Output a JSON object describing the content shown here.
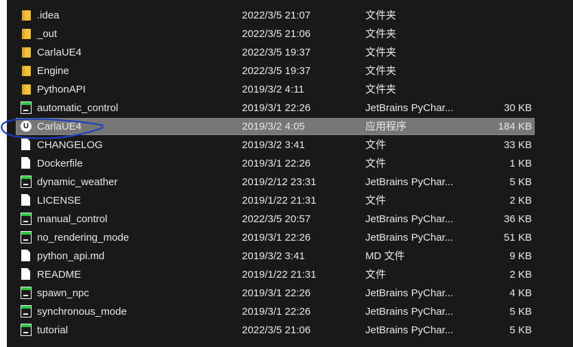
{
  "files": [
    {
      "name": ".idea",
      "date": "2022/3/5 21:07",
      "type": "文件夹",
      "size": "",
      "icon": "folder-icon"
    },
    {
      "name": "_out",
      "date": "2022/3/5 21:06",
      "type": "文件夹",
      "size": "",
      "icon": "folder-icon"
    },
    {
      "name": "CarlaUE4",
      "date": "2022/3/5 19:37",
      "type": "文件夹",
      "size": "",
      "icon": "folder-icon"
    },
    {
      "name": "Engine",
      "date": "2022/3/5 19:37",
      "type": "文件夹",
      "size": "",
      "icon": "folder-icon"
    },
    {
      "name": "PythonAPI",
      "date": "2019/3/2 4:11",
      "type": "文件夹",
      "size": "",
      "icon": "folder-icon"
    },
    {
      "name": "automatic_control",
      "date": "2019/3/1 22:26",
      "type": "JetBrains PyChar...",
      "size": "30 KB",
      "icon": "pycharm-file-icon"
    },
    {
      "name": "CarlaUE4",
      "date": "2019/3/2 4:05",
      "type": "应用程序",
      "size": "184 KB",
      "icon": "unreal-engine-icon",
      "selected": true
    },
    {
      "name": "CHANGELOG",
      "date": "2019/3/2 3:41",
      "type": "文件",
      "size": "33 KB",
      "icon": "document-icon"
    },
    {
      "name": "Dockerfile",
      "date": "2019/3/1 22:26",
      "type": "文件",
      "size": "1 KB",
      "icon": "document-icon"
    },
    {
      "name": "dynamic_weather",
      "date": "2019/2/12 23:31",
      "type": "JetBrains PyChar...",
      "size": "5 KB",
      "icon": "pycharm-file-icon"
    },
    {
      "name": "LICENSE",
      "date": "2019/1/22 21:31",
      "type": "文件",
      "size": "2 KB",
      "icon": "document-icon"
    },
    {
      "name": "manual_control",
      "date": "2022/3/5 20:57",
      "type": "JetBrains PyChar...",
      "size": "36 KB",
      "icon": "pycharm-file-icon"
    },
    {
      "name": "no_rendering_mode",
      "date": "2019/3/1 22:26",
      "type": "JetBrains PyChar...",
      "size": "51 KB",
      "icon": "pycharm-file-icon"
    },
    {
      "name": "python_api.md",
      "date": "2019/3/2 3:41",
      "type": "MD 文件",
      "size": "9 KB",
      "icon": "document-icon"
    },
    {
      "name": "README",
      "date": "2019/1/22 21:31",
      "type": "文件",
      "size": "2 KB",
      "icon": "document-icon"
    },
    {
      "name": "spawn_npc",
      "date": "2019/3/1 22:26",
      "type": "JetBrains PyChar...",
      "size": "4 KB",
      "icon": "pycharm-file-icon"
    },
    {
      "name": "synchronous_mode",
      "date": "2019/3/1 22:26",
      "type": "JetBrains PyChar...",
      "size": "5 KB",
      "icon": "pycharm-file-icon"
    },
    {
      "name": "tutorial",
      "date": "2022/3/5 21:06",
      "type": "JetBrains PyChar...",
      "size": "5 KB",
      "icon": "pycharm-file-icon"
    }
  ],
  "colors": {
    "background": "#191919",
    "selection": "#777777",
    "text": "#e8e8e8",
    "annotation": "#1b3fbf"
  }
}
